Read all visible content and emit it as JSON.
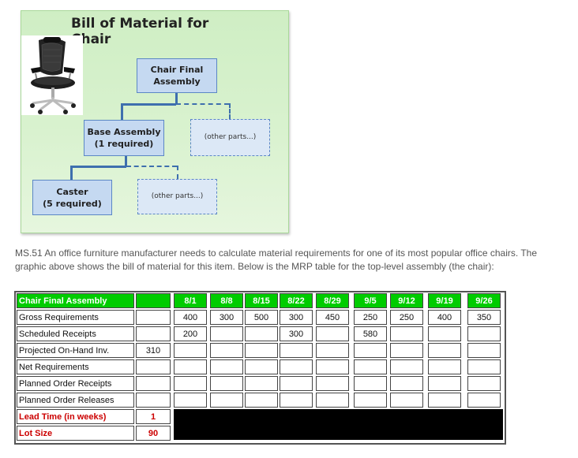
{
  "bom": {
    "title": "Bill of Material for Chair",
    "image_alt": "office-chair-photo",
    "nodes": {
      "final": [
        "Chair Final",
        "Assembly"
      ],
      "other1": "(other parts...)",
      "base": [
        "Base Assembly",
        "(1 required)"
      ],
      "other2": "(other parts...)",
      "caster": [
        "Caster",
        "(5 required)"
      ]
    },
    "colors": {
      "panel": "#d9f2cf",
      "node": "#c5d9f1",
      "connector": "#3e6fae"
    }
  },
  "problem_text": "MS.51 An office furniture manufacturer needs to calculate material requirements for one of its most popular office chairs. The graphic above shows the bill of material for this item. Below is the MRP table for the top-level assembly (the chair):",
  "mrp": {
    "title": "Chair Final Assembly",
    "periods": [
      "8/1",
      "8/8",
      "8/15",
      "8/22",
      "8/29",
      "9/5",
      "9/12",
      "9/19",
      "9/26"
    ],
    "rows": [
      {
        "label": "Gross Requirements",
        "initial": "",
        "values": [
          "400",
          "300",
          "500",
          "300",
          "450",
          "250",
          "250",
          "400",
          "350"
        ]
      },
      {
        "label": "Scheduled Receipts",
        "initial": "",
        "values": [
          "200",
          "",
          "",
          "300",
          "",
          "580",
          "",
          "",
          ""
        ]
      },
      {
        "label": "Projected On-Hand Inv.",
        "initial": "310",
        "values": [
          "",
          "",
          "",
          "",
          "",
          "",
          "",
          "",
          ""
        ]
      },
      {
        "label": "Net Requirements",
        "initial": "",
        "values": [
          "",
          "",
          "",
          "",
          "",
          "",
          "",
          "",
          ""
        ]
      },
      {
        "label": "Planned Order Receipts",
        "initial": "",
        "values": [
          "",
          "",
          "",
          "",
          "",
          "",
          "",
          "",
          ""
        ]
      },
      {
        "label": "Planned Order Releases",
        "initial": "",
        "values": [
          "",
          "",
          "",
          "",
          "",
          "",
          "",
          "",
          ""
        ]
      }
    ],
    "lead_time": {
      "label": "Lead Time (in weeks)",
      "value": "1"
    },
    "lot_size": {
      "label": "Lot Size",
      "value": "90"
    },
    "colors": {
      "header": "#00cc00",
      "emphasis": "#cc0000",
      "mask": "#000000"
    }
  }
}
